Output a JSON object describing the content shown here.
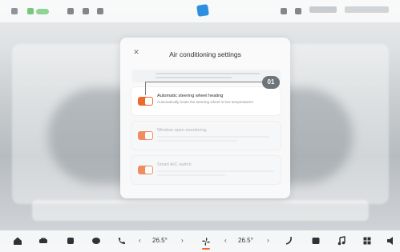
{
  "modal": {
    "title": "Air conditioning settings",
    "close_icon": "close-icon"
  },
  "items": [
    {
      "title": "Automatic steering wheel heating",
      "description": "Automatically heats the steering wheel in low temperatures",
      "enabled": true
    },
    {
      "title": "Window open monitoring",
      "description": "",
      "enabled": true
    },
    {
      "title": "Smart A/C switch",
      "description": "",
      "enabled": true
    }
  ],
  "callout": {
    "label": "01"
  },
  "dock": {
    "left_temp": "26.5°",
    "right_temp": "26.5°",
    "icons": [
      "home-icon",
      "car-icon",
      "seat-icon",
      "message-icon",
      "phone-icon",
      "fan-icon",
      "steering-icon",
      "media-icon",
      "music-icon",
      "apps-icon",
      "volume-icon"
    ]
  },
  "colors": {
    "accent": "#ee6a2c",
    "status_green": "#5fc06a",
    "logo_blue": "#2e8fe0"
  }
}
